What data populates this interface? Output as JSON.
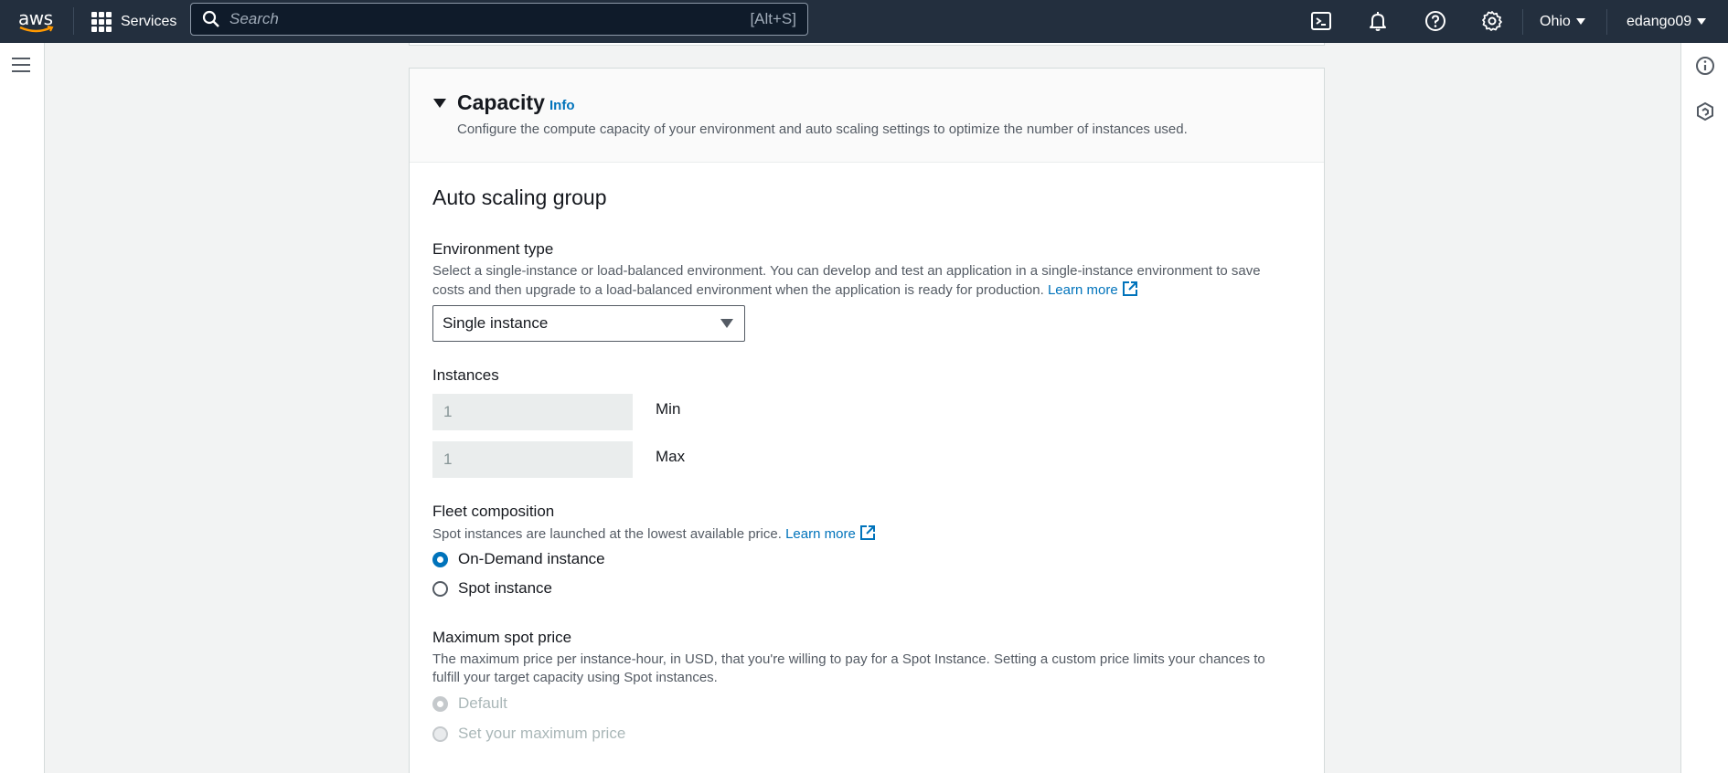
{
  "topnav": {
    "logo_text": "aws",
    "services_label": "Services",
    "search_placeholder": "Search",
    "search_shortcut": "[Alt+S]",
    "icons": [
      "cloudshell-icon",
      "bell-icon",
      "help-icon",
      "settings-icon"
    ],
    "region": "Ohio",
    "user": "edango09"
  },
  "right_rail": {
    "icons": [
      "info-icon",
      "hexagon-icon"
    ]
  },
  "panel": {
    "title": "Capacity",
    "info_label": "Info",
    "description": "Configure the compute capacity of your environment and auto scaling settings to optimize the number of instances used.",
    "section_title": "Auto scaling group",
    "environment_type": {
      "label": "Environment type",
      "description_line1": "Select a single-instance or load-balanced environment. You can develop and test an application in a single-instance environment to save",
      "description_line2": "costs and then upgrade to a load-balanced environment when the application is ready for production.",
      "learn_more": "Learn more",
      "selected": "Single instance"
    },
    "instances": {
      "label": "Instances",
      "min_value": "1",
      "min_label": "Min",
      "max_value": "1",
      "max_label": "Max"
    },
    "fleet_composition": {
      "label": "Fleet composition",
      "description": "Spot instances are launched at the lowest available price.",
      "learn_more": "Learn more",
      "options": [
        {
          "label": "On-Demand instance",
          "checked": true
        },
        {
          "label": "Spot instance",
          "checked": false
        }
      ]
    },
    "max_spot_price": {
      "label": "Maximum spot price",
      "description_line1": "The maximum price per instance-hour, in USD, that you're willing to pay for a Spot Instance. Setting a custom price limits your chances to",
      "description_line2": "fulfill your target capacity using Spot instances.",
      "options": [
        {
          "label": "Default",
          "checked": true,
          "disabled": true
        },
        {
          "label": "Set your maximum price",
          "checked": false,
          "disabled": true
        }
      ]
    }
  },
  "colors": {
    "nav_bg": "#232f3e",
    "link": "#0073bb",
    "page_bg": "#f2f3f3"
  }
}
